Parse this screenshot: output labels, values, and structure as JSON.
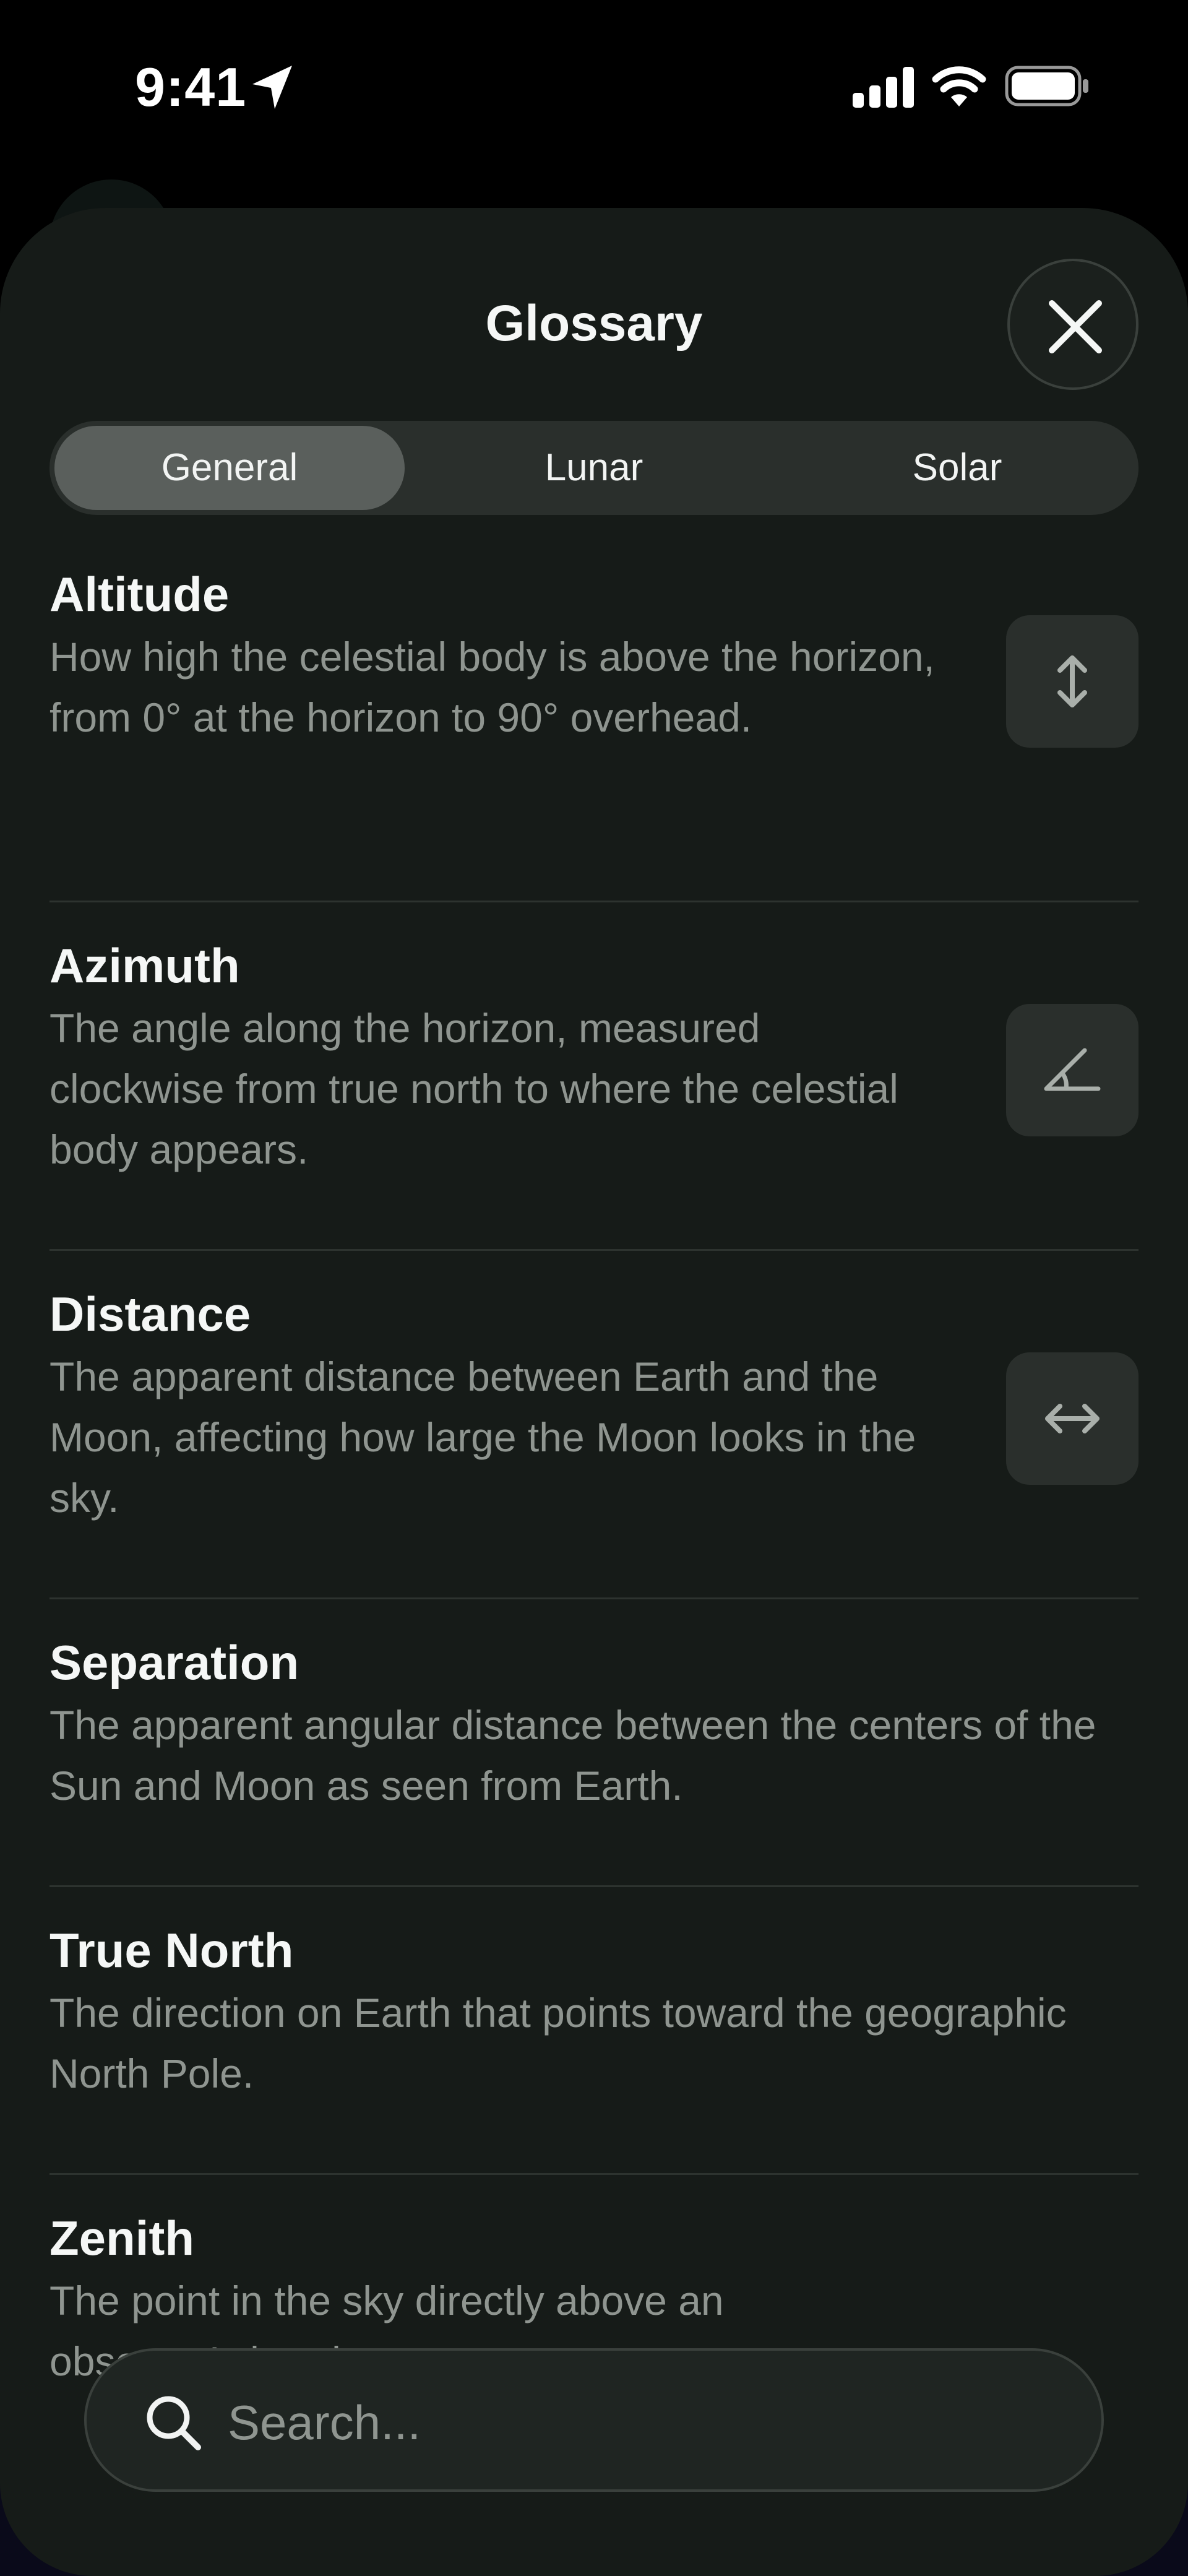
{
  "status_bar": {
    "time": "9:41",
    "icons": [
      "location-arrow-icon",
      "cellular-signal-icon",
      "wifi-icon",
      "battery-icon"
    ]
  },
  "sheet": {
    "title": "Glossary",
    "close_icon": "close-icon"
  },
  "tabs": [
    {
      "label": "General",
      "selected": true
    },
    {
      "label": "Lunar",
      "selected": false
    },
    {
      "label": "Solar",
      "selected": false
    }
  ],
  "terms": [
    {
      "term": "Altitude",
      "definition": "How high the celestial body is above the horizon, from 0° at the horizon to 90° overhead.",
      "icon": "vertical-arrows-icon"
    },
    {
      "term": "Azimuth",
      "definition": "The angle along the horizon, measured clockwise from true north to where the celestial body appears.",
      "icon": "angle-icon"
    },
    {
      "term": "Distance",
      "definition": "The apparent distance between Earth and the Moon, affecting how large the Moon looks in the sky.",
      "icon": "horizontal-arrows-icon"
    },
    {
      "term": "Separation",
      "definition": "The apparent angular distance between the centers of the Sun and Moon as seen from Earth."
    },
    {
      "term": "True North",
      "definition": "The direction on Earth that points toward the geographic North Pole."
    },
    {
      "term": "Zenith",
      "definition": "The point in the sky directly above an observer’s head."
    }
  ],
  "search": {
    "placeholder": "Search...",
    "value": "",
    "icon": "search-icon"
  },
  "colors": {
    "background": "#000000",
    "sheet": "#161b18",
    "tile": "#2a2f2c",
    "active_tab": "#5a5f5c",
    "secondary_text": "#8f9590"
  }
}
